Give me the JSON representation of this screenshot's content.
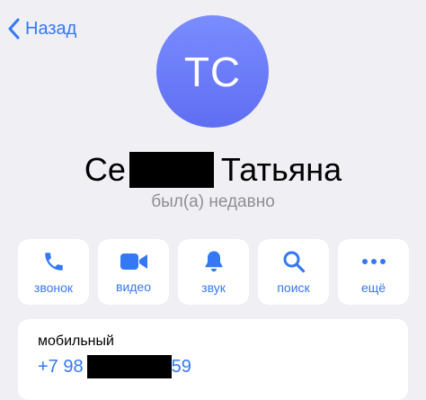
{
  "nav": {
    "back_label": "Назад",
    "back_icon": "chevron-left-icon"
  },
  "profile": {
    "initials": "TC",
    "name_prefix": "Се",
    "name_suffix": "Татьяна",
    "status": "был(а) недавно",
    "avatar_gradient": [
      "#7a8cff",
      "#5f6ef2"
    ]
  },
  "actions": [
    {
      "label": "звонок",
      "icon": "phone-icon"
    },
    {
      "label": "видео",
      "icon": "video-icon"
    },
    {
      "label": "звук",
      "icon": "bell-icon"
    },
    {
      "label": "поиск",
      "icon": "search-icon"
    },
    {
      "label": "ещё",
      "icon": "more-icon"
    }
  ],
  "phone_card": {
    "label": "мобильный",
    "number_prefix": "+7 98",
    "number_suffix": "59"
  },
  "colors": {
    "accent": "#3478f6",
    "background": "#efeff4",
    "secondary_text": "#8e8e93"
  }
}
